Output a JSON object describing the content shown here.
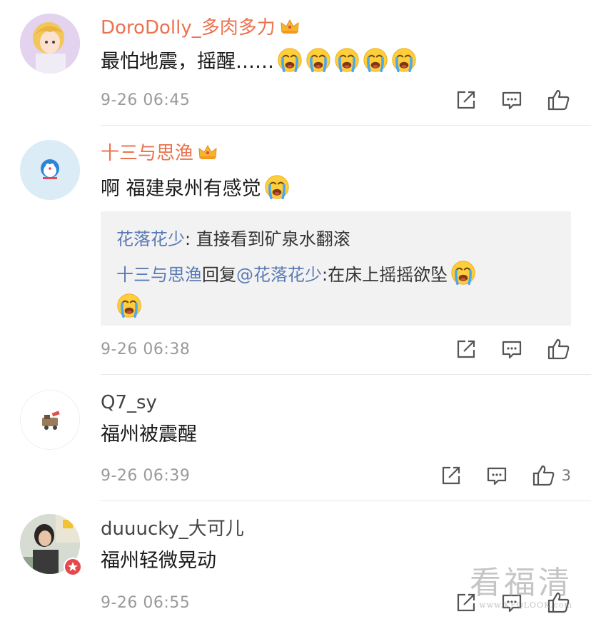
{
  "comments": [
    {
      "username": "DoroDolly_多肉多力",
      "text": "最怕地震，摇醒……",
      "time": "9-26 06:45",
      "likes": ""
    },
    {
      "username": "十三与思渔",
      "text": "啊 福建泉州有感觉",
      "time": "9-26 06:38",
      "likes": "",
      "replies": {
        "line1_user": "花落花少",
        "line1_text": ": 直接看到矿泉水翻滚",
        "line2_user": "十三与思渔",
        "line2_mid": "回复",
        "line2_mention": "@花落花少",
        "line2_text": ":在床上摇摇欲坠"
      }
    },
    {
      "username": "Q7_sy",
      "text": "福州被震醒",
      "time": "9-26 06:39",
      "likes": "3"
    },
    {
      "username": "duuucky_大可儿",
      "text": "福州轻微晃动",
      "time": "9-26 06:55",
      "likes": ""
    }
  ],
  "icons": {
    "vip_badge": "crown-icon",
    "emoji": "crying-face-icon",
    "share": "share-icon",
    "comment": "comment-icon",
    "like": "thumbs-up-icon",
    "verified": "verified-badge-icon"
  },
  "colors": {
    "vip_name": "#eb7350",
    "link_blue": "#5a7ab5",
    "meta_gray": "#9a9a9a",
    "reply_bg": "#f2f2f2"
  },
  "watermark": {
    "title": "看福清",
    "site": "www.KFQLOOK.com"
  }
}
